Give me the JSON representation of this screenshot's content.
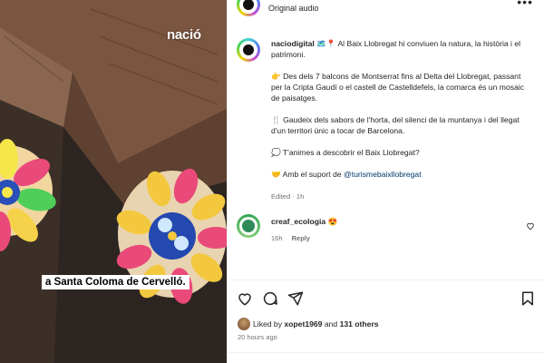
{
  "media": {
    "watermark": "nació",
    "caption": "a Santa Coloma de Cervelló."
  },
  "header": {
    "audio": "Original audio",
    "more_icon": "more-horizontal-icon"
  },
  "post": {
    "username": "naciodigital",
    "line1": "🗺️📍 Al Baix Llobregat hi conviuen la natura, la història i el patrimoni.",
    "para2": "👉 Des dels 7 balcons de Montserrat fins al Delta del Llobregat, passant per la Cripta Gaudí o el castell de Castelldefels, la comarca és un mosaic de paisatges.",
    "para3": "🍴 Gaudeix dels sabors de l'horta, del silenci de la muntanya i del llegat d'un territori únic a tocar de Barcelona.",
    "para4": "💭 T'animes a descobrir el Baix Llobregat?",
    "para5_prefix": "🤝 Amb el suport de ",
    "para5_link": "@turismebaixllobregat",
    "edited": "Edited · 1h"
  },
  "comment": {
    "username": "creaf_ecologia",
    "text": "😍",
    "age": "16h",
    "reply": "Reply"
  },
  "actions": {
    "like_icon": "heart-icon",
    "comment_icon": "comment-icon",
    "share_icon": "send-icon",
    "save_icon": "bookmark-icon"
  },
  "likes": {
    "prefix": "Liked by ",
    "user": "xopet1969",
    "middle": " and ",
    "count": "131 others"
  },
  "time": "20 hours ago",
  "colors": {
    "link": "#00376b",
    "muted": "#737373",
    "text": "#262626"
  }
}
